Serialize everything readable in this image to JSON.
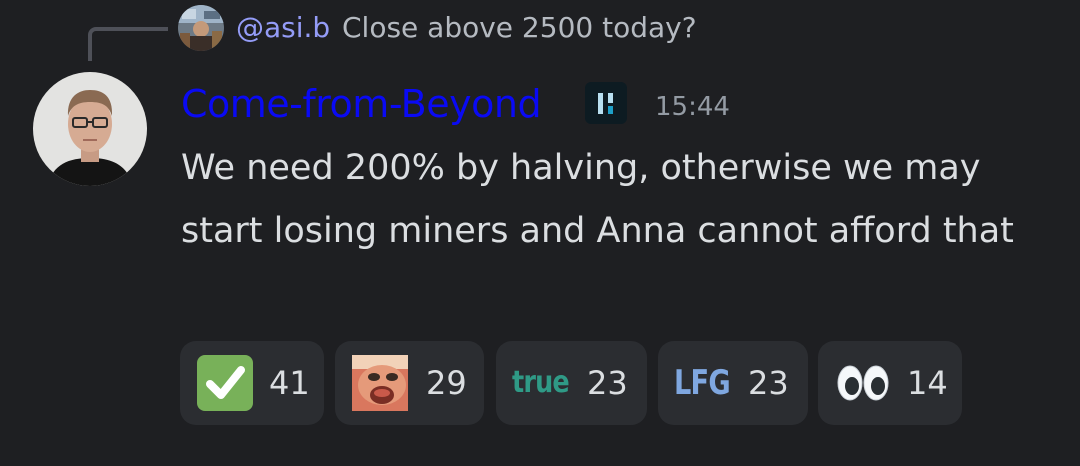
{
  "reply": {
    "author": "@asi.b",
    "text": "Close above 2500 today?",
    "avatar_icon": "user-avatar-icon"
  },
  "message": {
    "author": "Come-from-Beyond",
    "author_color": "#0a0af4",
    "role_icon": "role-badge-icon",
    "timestamp": "15:44",
    "text": "We need 200% by halving, otherwise we may start losing miners and Anna cannot afford that",
    "avatar_icon": "user-avatar-icon"
  },
  "reactions": [
    {
      "emoji": "white-check-mark",
      "count": "41"
    },
    {
      "emoji": "pog-face",
      "count": "29"
    },
    {
      "emoji": "true",
      "label": "true",
      "count": "23"
    },
    {
      "emoji": "lfg",
      "label": "LFG",
      "count": "23"
    },
    {
      "emoji": "eyes",
      "count": "14"
    }
  ]
}
